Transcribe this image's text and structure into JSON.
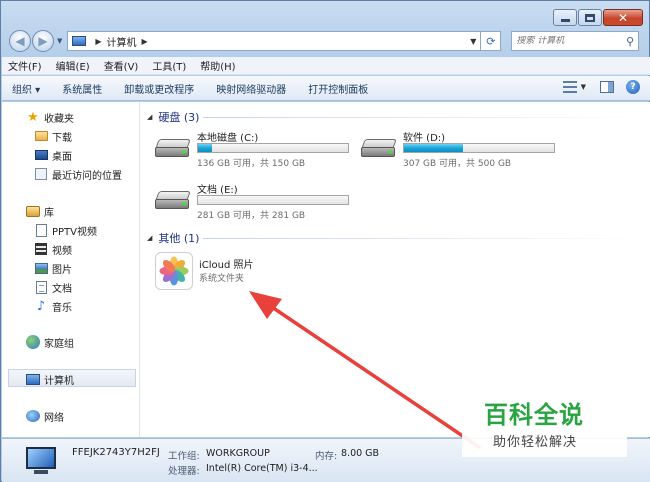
{
  "address": {
    "path": "计算机",
    "search_placeholder": "搜索 计算机"
  },
  "menubar": {
    "items": [
      "文件(F)",
      "编辑(E)",
      "查看(V)",
      "工具(T)",
      "帮助(H)"
    ]
  },
  "toolbar": {
    "items": [
      "组织 ▾",
      "系统属性",
      "卸载或更改程序",
      "映射网络驱动器",
      "打开控制面板"
    ]
  },
  "sidebar": {
    "favorites": "收藏夹",
    "fav_items": [
      "下载",
      "桌面",
      "最近访问的位置"
    ],
    "libraries": "库",
    "lib_items": [
      "PPTV视频",
      "视频",
      "图片",
      "文档",
      "音乐"
    ],
    "homegroup": "家庭组",
    "computer": "计算机",
    "network": "网络"
  },
  "main": {
    "hdd_group": "硬盘 (3)",
    "other_group": "其他 (1)",
    "drives": [
      {
        "name": "本地磁盘 (C:)",
        "info": "136 GB 可用，共 150 GB",
        "used_fraction": 0.09
      },
      {
        "name": "软件 (D:)",
        "info": "307 GB 可用，共 500 GB",
        "used_fraction": 0.39
      },
      {
        "name": "文档 (E:)",
        "info": "281 GB 可用，共 281 GB",
        "used_fraction": 0.0
      }
    ],
    "icloud": {
      "name": "iCloud 照片",
      "type": "系统文件夹"
    }
  },
  "details": {
    "computer_name": "FFEJK2743Y7H2FJ",
    "workgroup_label": "工作组:",
    "workgroup": "WORKGROUP",
    "memory_label": "内存:",
    "memory": "8.00 GB",
    "cpu_label": "处理器:",
    "cpu": "Intel(R) Core(TM) i3-4..."
  },
  "watermark": {
    "title": "百科全说",
    "subtitle": "助你轻松解决"
  },
  "colors": {
    "group_head": "#1e3287",
    "drive_bar": "#1ba5d8",
    "annotation_arrow": "#e8403a",
    "watermark_green": "#2aa442"
  }
}
